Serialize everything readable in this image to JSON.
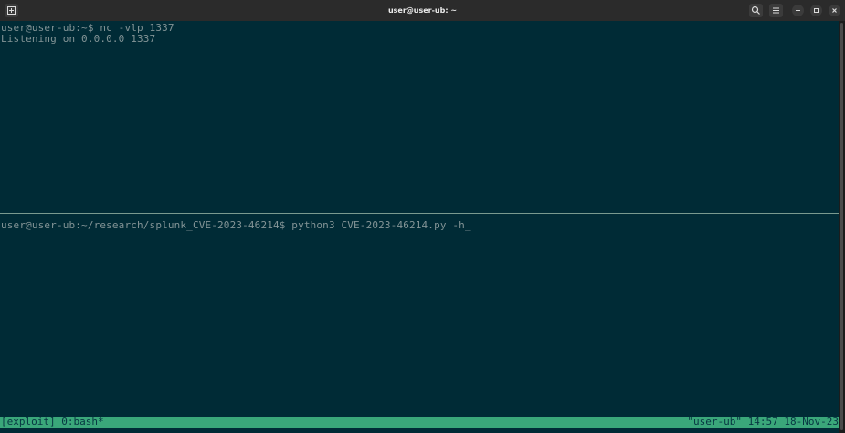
{
  "window": {
    "title": "user@user-ub: ~",
    "left_icon": "new-tab-icon",
    "controls": {
      "search_icon": "search-icon",
      "menu_icon": "hamburger-menu-icon",
      "minimize_icon": "minimize-icon",
      "maximize_icon": "maximize-icon",
      "close_icon": "close-icon"
    }
  },
  "top_pane": {
    "lines": [
      "user@user-ub:~$ nc -vlp 1337",
      "Listening on 0.0.0.0 1337"
    ]
  },
  "bottom_pane": {
    "lines": [
      "user@user-ub:~/research/splunk_CVE-2023-46214$ python3 CVE-2023-46214.py -h_"
    ]
  },
  "tmux_status": {
    "left": "[exploit] 0:bash*",
    "right": "\"user-ub\" 14:57 18-Nov-23"
  },
  "colors": {
    "terminal_bg": "#002b36",
    "terminal_fg": "#839496",
    "status_bg": "#3aa77a",
    "titlebar_bg": "#2b2b2b"
  }
}
